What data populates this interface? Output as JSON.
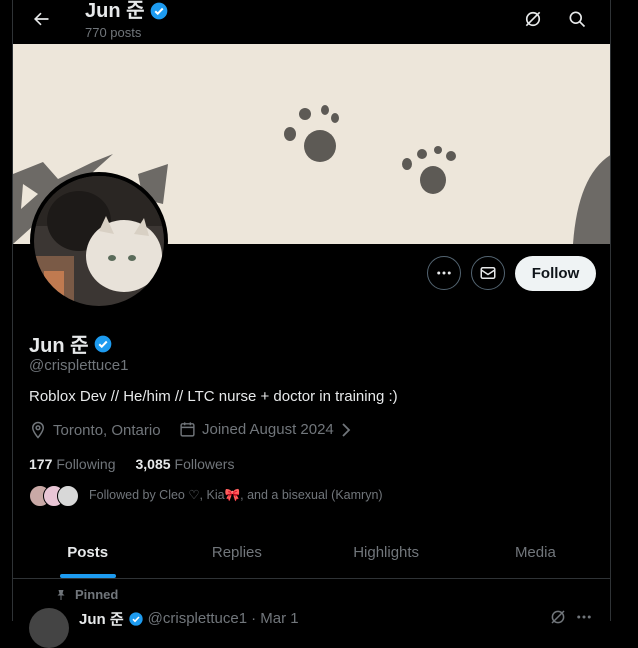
{
  "header": {
    "name": "Jun 준",
    "posts": "770 posts"
  },
  "profile": {
    "name": "Jun 준",
    "handle": "@crisplettuce1",
    "bio": "Roblox Dev // He/him // LTC nurse + doctor in training :)",
    "location": "Toronto, Ontario",
    "joined": "Joined August 2024",
    "following_count": "177",
    "following_label": "Following",
    "followers_count": "3,085",
    "followers_label": "Followers",
    "followed_by": "Followed by Cleo ♡, Kia🎀, and a bisexual (Kamryn)",
    "follow_label": "Follow"
  },
  "tabs": [
    {
      "label": "Posts"
    },
    {
      "label": "Replies"
    },
    {
      "label": "Highlights"
    },
    {
      "label": "Media"
    }
  ],
  "pinned_label": "Pinned",
  "tweet": {
    "name": "Jun 준",
    "handle": "@crisplettuce1",
    "date": "· Mar 1"
  },
  "colors": {
    "accent": "#1d9bf0",
    "verified": "#1d9bf0",
    "banner": "#ede6da"
  },
  "icons": [
    "back-arrow-icon",
    "grok-icon",
    "search-icon",
    "more-icon",
    "message-icon",
    "verified-icon",
    "location-icon",
    "calendar-icon",
    "pin-icon"
  ]
}
